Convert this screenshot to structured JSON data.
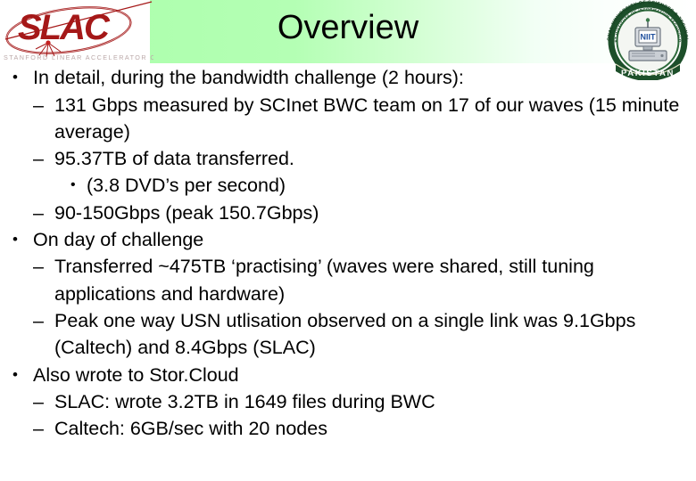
{
  "slide": {
    "title": "Overview",
    "logos": {
      "left": {
        "name": "SLAC",
        "wordmark": "SLAC",
        "tagline": "STANFORD LINEAR ACCELERATOR CENTER",
        "color": "#a51818"
      },
      "right": {
        "name": "NUST Institute of Information Technology",
        "ring_text": "NATIONAL UNIVERSITY OF SCIENCES & TECHNOLOGY",
        "inner_text": "NUST INSTITUTE OF INFORMATION TECHNOLOGY",
        "banner_text": "PAKISTAN",
        "color": "#1d4f2a"
      }
    },
    "colors": {
      "header_green": "#b0ffb0",
      "header_fade": "#ffffff",
      "text": "#000000",
      "tagline_gray": "#b9a8a8"
    },
    "markers": {
      "level1": "•",
      "level2": "–",
      "level3": "•"
    },
    "bullets": [
      {
        "level": 1,
        "text": "In detail, during the bandwidth challenge (2 hours):"
      },
      {
        "level": 2,
        "text": "131 Gbps measured by SCInet BWC team on 17 of our waves (15 minute average)"
      },
      {
        "level": 2,
        "text": "95.37TB of data transferred."
      },
      {
        "level": 3,
        "text": "(3.8 DVD’s per second)"
      },
      {
        "level": 2,
        "text": "90-150Gbps (peak 150.7Gbps)"
      },
      {
        "level": 1,
        "text": "On day of challenge"
      },
      {
        "level": 2,
        "text": "Transferred ~475TB ‘practising’ (waves were shared, still tuning applications and hardware)"
      },
      {
        "level": 2,
        "text": "Peak one way USN utlisation observed on a single link was 9.1Gbps (Caltech) and 8.4Gbps (SLAC)"
      },
      {
        "level": 1,
        "text": "Also wrote to Stor.Cloud"
      },
      {
        "level": 2,
        "text": "SLAC: wrote 3.2TB in 1649 files during BWC"
      },
      {
        "level": 2,
        "text": "Caltech: 6GB/sec with 20 nodes"
      }
    ]
  }
}
